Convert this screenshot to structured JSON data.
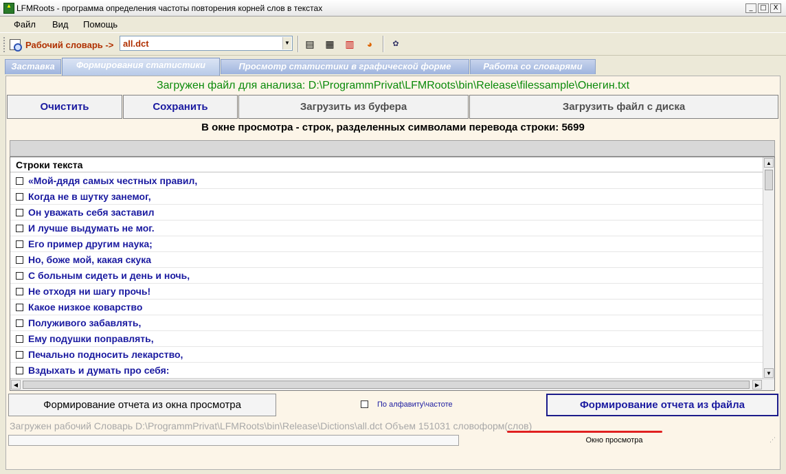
{
  "window": {
    "title": "LFMRoots - программа определения частоты повторения корней слов в текстах",
    "controls": [
      "_",
      "□",
      "X"
    ]
  },
  "menu": [
    "Файл",
    "Вид",
    "Помощь"
  ],
  "toolbar": {
    "dictionary_label": "Рабочий словарь ->",
    "dictionary_value": "all.dct"
  },
  "tabs": [
    "Заставка",
    "Формирования статистики",
    "Просмотр статистики в графической форме",
    "Работа со словарями"
  ],
  "loaded_file": "Загружен файл для анализа: D:\\ProgrammPrivat\\LFMRoots\\bin\\Release\\filessample\\Онегин.txt",
  "buttons": {
    "clear": "Очистить",
    "save": "Сохранить",
    "load_clipboard": "Загрузить из буфера",
    "load_file": "Загрузить файл с диска"
  },
  "line_count": "В окне просмотра - строк, разделенных символами перевода строки: 5699",
  "grid": {
    "header": "Строки текста",
    "rows": [
      "«Мой-дядя самых честных правил,",
      "Когда не в шутку занемог,",
      "Он уважать себя заставил",
      "И лучше выдумать не мог.",
      "Его пример другим наука;",
      "Но, боже мой, какая скука",
      "С больным сидеть и день и ночь,",
      "Не отходя ни шагу прочь!",
      "Какое низкое коварство",
      "Полуживого забавлять,",
      "Ему подушки поправлять,",
      "Печально подносить лекарство,",
      "Вздыхать и думать про себя:"
    ]
  },
  "report": {
    "from_view": "Формирование отчета из окна просмотра",
    "sort_label": "По алфавиту\\частоте",
    "from_file": "Формирование отчета из файла"
  },
  "status": {
    "dictionary": "Загружен рабочий Словарь D:\\ProgrammPrivat\\LFMRoots\\bin\\Release\\Dictions\\all.dct Объем 151031 словоформ(слов)",
    "panel_label": "Окно просмотра"
  },
  "colors": {
    "tab_gradient": "#b8cae8",
    "loaded_file_text": "#0a8a0a",
    "row_text": "#1a1aa0",
    "dictionary_label": "#b03000",
    "underline": "#e02020"
  }
}
